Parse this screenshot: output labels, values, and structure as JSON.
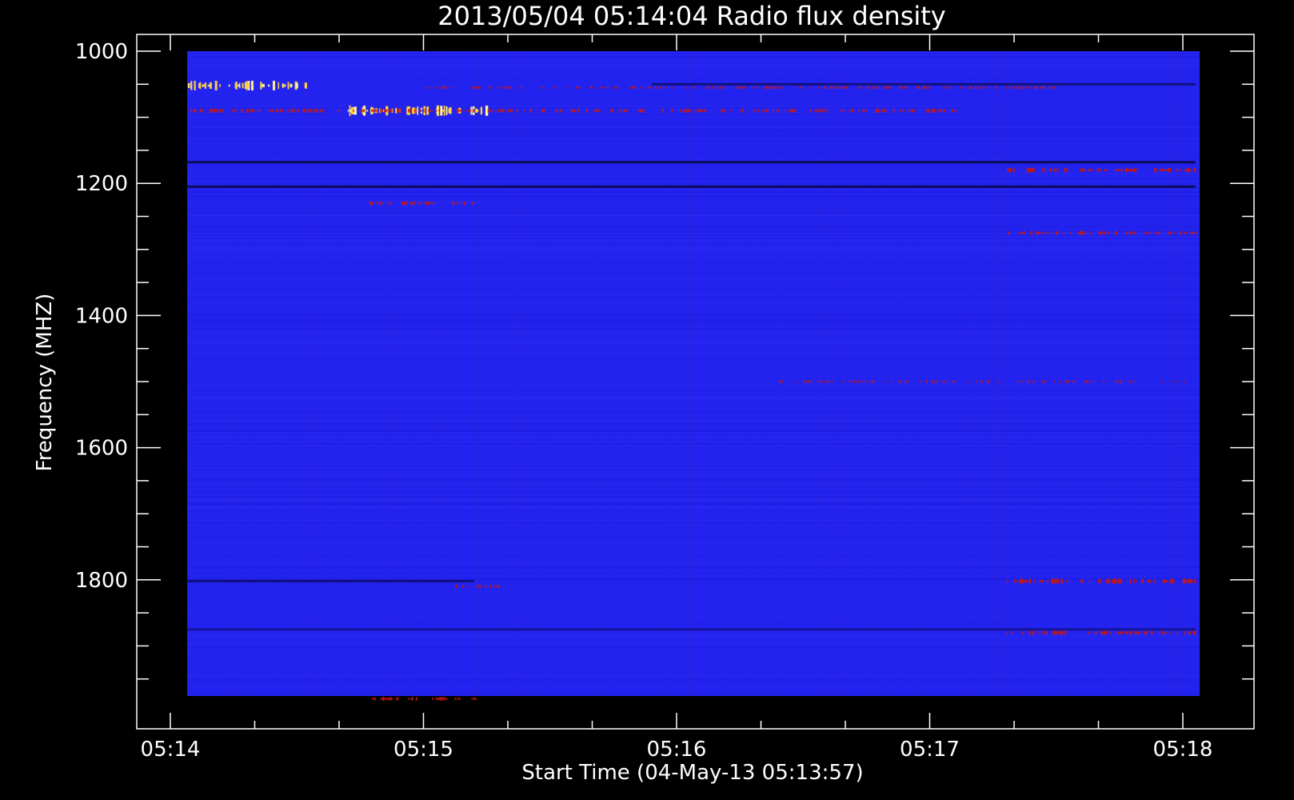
{
  "chart_data": {
    "type": "heatmap",
    "title": "2013/05/04 05:14:04 Radio flux density",
    "xlabel": "Start Time (04-May-13 05:13:57)",
    "ylabel": "Frequency (MHZ)",
    "x_ticks": [
      "05:14",
      "05:15",
      "05:16",
      "05:17",
      "05:18"
    ],
    "y_ticks": [
      "1000",
      "1200",
      "1400",
      "1600",
      "1800"
    ],
    "xlim_minutes": [
      -0.14,
      4.28
    ],
    "ylim_mhz": [
      1000,
      2000
    ],
    "data_time_range": [
      "05:14:04",
      "05:18:04"
    ],
    "data_freq_range_mhz": [
      1000,
      2000
    ],
    "colormap": "blue-red-yellow",
    "background_color": "#000000",
    "axis_color": "#ffffff",
    "base_color": "#2323f0",
    "hot_color": "#ffd040",
    "warm_color": "#c01818",
    "dark_color": "#050530",
    "features": [
      {
        "kind": "hot",
        "freq": 1052,
        "t": [
          0.0,
          0.55
        ],
        "intensity": 0.9
      },
      {
        "kind": "hot",
        "freq": 1090,
        "t": [
          0.7,
          1.25
        ],
        "intensity": 1.0
      },
      {
        "kind": "warm",
        "freq": 1090,
        "t": [
          0.0,
          3.1
        ],
        "intensity": 0.55
      },
      {
        "kind": "warm",
        "freq": 1055,
        "t": [
          1.0,
          3.5
        ],
        "intensity": 0.35
      },
      {
        "kind": "warm",
        "freq": 1230,
        "t": [
          0.75,
          1.2
        ],
        "intensity": 0.5
      },
      {
        "kind": "warm",
        "freq": 1180,
        "t": [
          3.3,
          4.05
        ],
        "intensity": 0.7
      },
      {
        "kind": "warm",
        "freq": 1275,
        "t": [
          3.3,
          4.05
        ],
        "intensity": 0.5
      },
      {
        "kind": "warm",
        "freq": 1810,
        "t": [
          1.1,
          1.3
        ],
        "intensity": 0.4
      },
      {
        "kind": "warm",
        "freq": 1802,
        "t": [
          3.3,
          4.05
        ],
        "intensity": 0.8
      },
      {
        "kind": "warm",
        "freq": 1880,
        "t": [
          3.3,
          4.05
        ],
        "intensity": 0.6
      },
      {
        "kind": "warm",
        "freq": 1500,
        "t": [
          2.4,
          4.05
        ],
        "intensity": 0.3
      },
      {
        "kind": "warm",
        "freq": 1980,
        "t": [
          0.75,
          1.2
        ],
        "intensity": 0.5
      },
      {
        "kind": "dark",
        "freq": 1168,
        "t": [
          0.0,
          4.05
        ],
        "intensity": 0.8
      },
      {
        "kind": "dark",
        "freq": 1205,
        "t": [
          0.0,
          4.05
        ],
        "intensity": 0.8
      },
      {
        "kind": "dark",
        "freq": 1802,
        "t": [
          0.0,
          1.2
        ],
        "intensity": 0.6
      },
      {
        "kind": "dark",
        "freq": 1875,
        "t": [
          0.0,
          4.05
        ],
        "intensity": 0.45
      },
      {
        "kind": "dark",
        "freq": 1050,
        "t": [
          1.9,
          4.05
        ],
        "intensity": 0.6
      }
    ]
  }
}
